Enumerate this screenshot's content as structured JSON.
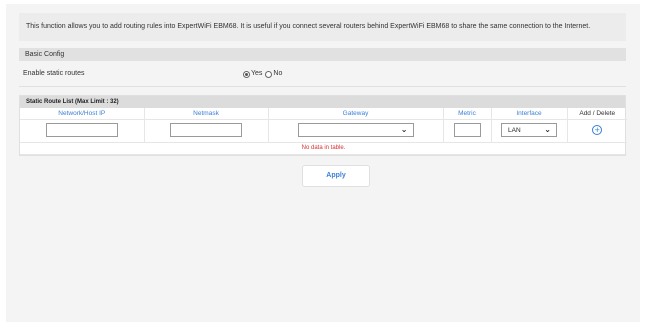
{
  "notice": {
    "text": "This function allows you to add routing rules into ExpertWiFi EBM68. It is useful if you connect several routers behind ExpertWiFi EBM68 to share the same connection to the Internet."
  },
  "basic_config": {
    "title": "Basic Config",
    "enable_label": "Enable static routes",
    "options": {
      "yes": "Yes",
      "no": "No"
    },
    "selected": "Yes"
  },
  "route_table": {
    "caption": "Static Route List (Max Limit : 32)",
    "columns": {
      "network": "Network/Host IP",
      "netmask": "Netmask",
      "gateway": "Gateway",
      "metric": "Metric",
      "interface": "Interface",
      "add_delete": "Add / Delete"
    },
    "new_row": {
      "network": "",
      "netmask": "",
      "gateway": "",
      "metric": "",
      "interface": "LAN"
    },
    "empty_message": "No data in table."
  },
  "actions": {
    "apply": "Apply"
  },
  "colors": {
    "accent": "#3b7fd8",
    "empty_text": "#d93030",
    "panel_bg": "#f4f4f4"
  },
  "icons": {
    "dropdown": "chevron-down-icon",
    "add": "plus-circle-icon"
  }
}
